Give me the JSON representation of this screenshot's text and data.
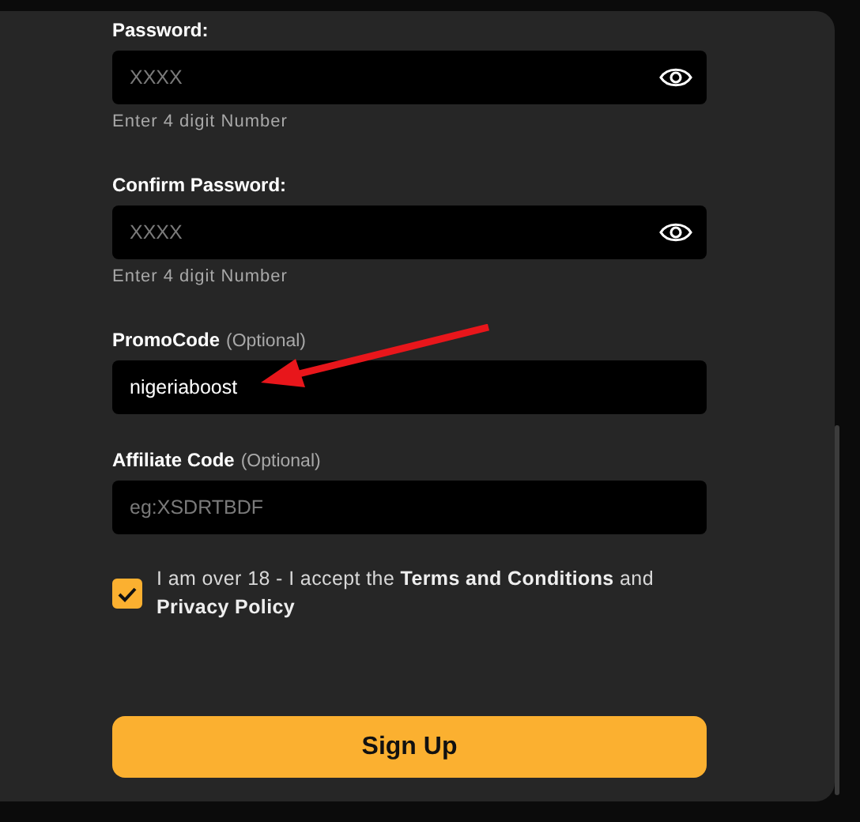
{
  "fields": [
    {
      "kind": "secret",
      "label": "Password:",
      "placeholder": "XXXX",
      "hint": "Enter 4 digit Number"
    },
    {
      "kind": "secret",
      "label": "Confirm Password:",
      "placeholder": "XXXX",
      "hint": "Enter 4 digit Number"
    },
    {
      "kind": "text",
      "label": "PromoCode",
      "optional": "(Optional)",
      "value": "nigeriaboost"
    },
    {
      "kind": "text",
      "label": "Affiliate Code",
      "optional": "(Optional)",
      "placeholder": "eg:XSDRTBDF"
    }
  ],
  "consent": {
    "checked": true,
    "parts": [
      {
        "kind": "text",
        "text": "I am over 18 - I accept the"
      },
      {
        "kind": "link",
        "text": "Terms and Conditions"
      },
      {
        "kind": "text",
        "text": "and"
      },
      {
        "kind": "link",
        "text": "Privacy Policy"
      }
    ]
  },
  "submit": {
    "label": "Sign Up"
  }
}
